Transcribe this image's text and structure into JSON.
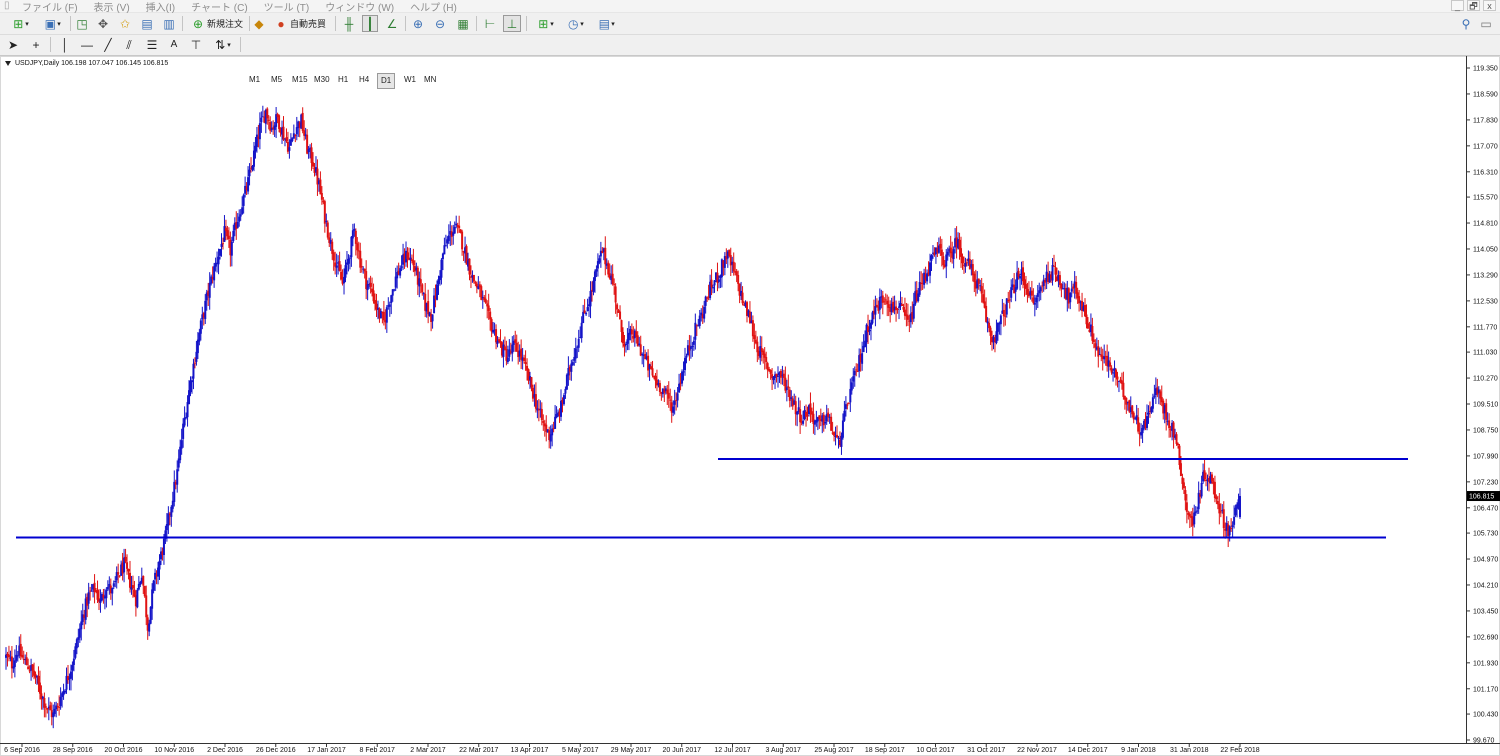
{
  "menu": {
    "items": [
      "ファイル (F)",
      "表示 (V)",
      "挿入(I)",
      "チャート (C)",
      "ツール (T)",
      "ウィンドウ (W)",
      "ヘルプ (H)"
    ],
    "window_controls": [
      "_",
      "🗗",
      "x"
    ]
  },
  "toolbar": {
    "new_order_label": "新規注文",
    "auto_trade_label": "自動売買"
  },
  "timeframes": [
    "M1",
    "M5",
    "M15",
    "M30",
    "H1",
    "H4",
    "D1",
    "W1",
    "MN"
  ],
  "active_timeframe": "D1",
  "chart": {
    "symbol_info": "USDJPY,Daily  106.198 107.047 106.145 106.815",
    "current_price": "106.815"
  },
  "colors": {
    "bull": "#1414c8",
    "bear": "#e01212",
    "hline": "#0000d0"
  },
  "chart_data": {
    "type": "candlestick",
    "symbol": "USDJPY",
    "timeframe": "Daily",
    "last_bar": {
      "open": 106.198,
      "high": 107.047,
      "low": 106.145,
      "close": 106.815
    },
    "current_price": 106.815,
    "ylim": [
      99.67,
      119.35
    ],
    "y_ticks": [
      "119.350",
      "118.590",
      "117.830",
      "117.070",
      "116.310",
      "115.570",
      "114.810",
      "114.050",
      "113.290",
      "112.530",
      "111.770",
      "111.030",
      "110.270",
      "109.510",
      "108.750",
      "107.990",
      "107.230",
      "106.470",
      "105.730",
      "104.970",
      "104.210",
      "103.450",
      "102.690",
      "101.930",
      "101.170",
      "100.430",
      "99.670"
    ],
    "x_ticks": [
      "6 Sep 2016",
      "28 Sep 2016",
      "20 Oct 2016",
      "10 Nov 2016",
      "2 Dec 2016",
      "26 Dec 2016",
      "17 Jan 2017",
      "8 Feb 2017",
      "2 Mar 2017",
      "22 Mar 2017",
      "13 Apr 2017",
      "5 May 2017",
      "29 May 2017",
      "20 Jun 2017",
      "12 Jul 2017",
      "3 Aug 2017",
      "25 Aug 2017",
      "18 Sep 2017",
      "10 Oct 2017",
      "31 Oct 2017",
      "22 Nov 2017",
      "14 Dec 2017",
      "9 Jan 2018",
      "31 Jan 2018",
      "22 Feb 2018"
    ],
    "close_path": [
      [
        0,
        102.1
      ],
      [
        4,
        101.9
      ],
      [
        8,
        102.3
      ],
      [
        12,
        102.0
      ],
      [
        16,
        101.8
      ],
      [
        20,
        101.5
      ],
      [
        24,
        101.0
      ],
      [
        28,
        100.6
      ],
      [
        32,
        100.4
      ],
      [
        36,
        100.8
      ],
      [
        40,
        101.3
      ],
      [
        44,
        101.8
      ],
      [
        48,
        102.5
      ],
      [
        52,
        103.3
      ],
      [
        56,
        103.9
      ],
      [
        60,
        104.1
      ],
      [
        64,
        103.7
      ],
      [
        68,
        104.2
      ],
      [
        72,
        104.0
      ],
      [
        76,
        104.5
      ],
      [
        80,
        104.8
      ],
      [
        84,
        104.3
      ],
      [
        88,
        103.8
      ],
      [
        92,
        104.6
      ],
      [
        96,
        103.0
      ],
      [
        100,
        104.2
      ],
      [
        104,
        104.9
      ],
      [
        108,
        105.6
      ],
      [
        112,
        106.6
      ],
      [
        116,
        107.5
      ],
      [
        120,
        108.8
      ],
      [
        124,
        109.9
      ],
      [
        128,
        110.9
      ],
      [
        132,
        111.8
      ],
      [
        136,
        112.6
      ],
      [
        140,
        113.3
      ],
      [
        144,
        113.9
      ],
      [
        148,
        114.5
      ],
      [
        152,
        114.0
      ],
      [
        156,
        114.8
      ],
      [
        160,
        115.4
      ],
      [
        164,
        116.0
      ],
      [
        168,
        116.8
      ],
      [
        172,
        117.6
      ],
      [
        176,
        118.1
      ],
      [
        180,
        117.6
      ],
      [
        184,
        117.9
      ],
      [
        188,
        117.4
      ],
      [
        192,
        117.0
      ],
      [
        196,
        117.6
      ],
      [
        200,
        117.8
      ],
      [
        204,
        117.0
      ],
      [
        208,
        116.6
      ],
      [
        212,
        115.9
      ],
      [
        216,
        115.0
      ],
      [
        220,
        114.2
      ],
      [
        224,
        113.6
      ],
      [
        228,
        113.0
      ],
      [
        232,
        113.8
      ],
      [
        236,
        114.6
      ],
      [
        240,
        113.7
      ],
      [
        244,
        113.1
      ],
      [
        248,
        112.8
      ],
      [
        252,
        112.2
      ],
      [
        256,
        111.9
      ],
      [
        260,
        112.6
      ],
      [
        264,
        113.2
      ],
      [
        268,
        113.6
      ],
      [
        272,
        113.9
      ],
      [
        276,
        113.6
      ],
      [
        280,
        113.0
      ],
      [
        284,
        112.4
      ],
      [
        288,
        112.1
      ],
      [
        292,
        112.9
      ],
      [
        296,
        113.9
      ],
      [
        300,
        114.4
      ],
      [
        304,
        114.7
      ],
      [
        308,
        114.4
      ],
      [
        312,
        113.8
      ],
      [
        316,
        113.2
      ],
      [
        320,
        112.9
      ],
      [
        324,
        112.4
      ],
      [
        328,
        111.9
      ],
      [
        332,
        111.5
      ],
      [
        336,
        111.1
      ],
      [
        340,
        110.9
      ],
      [
        344,
        111.2
      ],
      [
        348,
        111.0
      ],
      [
        352,
        110.5
      ],
      [
        356,
        110.0
      ],
      [
        360,
        109.4
      ],
      [
        364,
        108.9
      ],
      [
        368,
        108.6
      ],
      [
        372,
        109.0
      ],
      [
        376,
        109.4
      ],
      [
        380,
        110.2
      ],
      [
        384,
        110.9
      ],
      [
        388,
        111.5
      ],
      [
        392,
        112.2
      ],
      [
        396,
        112.7
      ],
      [
        400,
        113.4
      ],
      [
        404,
        114.0
      ],
      [
        408,
        113.5
      ],
      [
        412,
        112.9
      ],
      [
        416,
        111.8
      ],
      [
        420,
        111.2
      ],
      [
        424,
        111.6
      ],
      [
        428,
        111.3
      ],
      [
        432,
        110.9
      ],
      [
        436,
        110.5
      ],
      [
        440,
        110.2
      ],
      [
        444,
        110.0
      ],
      [
        448,
        109.7
      ],
      [
        452,
        109.4
      ],
      [
        456,
        110.1
      ],
      [
        460,
        110.8
      ],
      [
        464,
        111.3
      ],
      [
        468,
        111.8
      ],
      [
        472,
        112.2
      ],
      [
        476,
        112.8
      ],
      [
        480,
        113.1
      ],
      [
        484,
        113.4
      ],
      [
        488,
        113.9
      ],
      [
        492,
        113.5
      ],
      [
        496,
        113.0
      ],
      [
        500,
        112.4
      ],
      [
        504,
        112.0
      ],
      [
        508,
        111.3
      ],
      [
        512,
        110.9
      ],
      [
        516,
        110.6
      ],
      [
        520,
        110.3
      ],
      [
        524,
        110.4
      ],
      [
        528,
        110.1
      ],
      [
        532,
        109.7
      ],
      [
        536,
        109.3
      ],
      [
        540,
        109.1
      ],
      [
        544,
        109.4
      ],
      [
        548,
        109.0
      ],
      [
        552,
        108.9
      ],
      [
        556,
        109.2
      ],
      [
        560,
        108.7
      ],
      [
        564,
        108.3
      ],
      [
        568,
        109.1
      ],
      [
        572,
        109.9
      ],
      [
        576,
        110.4
      ],
      [
        580,
        111.1
      ],
      [
        584,
        111.8
      ],
      [
        588,
        112.2
      ],
      [
        592,
        112.5
      ],
      [
        596,
        112.7
      ],
      [
        600,
        112.3
      ],
      [
        604,
        112.4
      ],
      [
        608,
        112.1
      ],
      [
        612,
        111.8
      ],
      [
        616,
        112.6
      ],
      [
        620,
        113.0
      ],
      [
        624,
        113.4
      ],
      [
        628,
        113.8
      ],
      [
        632,
        114.0
      ],
      [
        636,
        113.7
      ],
      [
        640,
        113.9
      ],
      [
        644,
        114.3
      ],
      [
        648,
        113.8
      ],
      [
        652,
        113.6
      ],
      [
        656,
        113.2
      ],
      [
        660,
        112.8
      ],
      [
        664,
        112.0
      ],
      [
        668,
        111.4
      ],
      [
        672,
        111.7
      ],
      [
        676,
        112.2
      ],
      [
        680,
        112.6
      ],
      [
        684,
        113.1
      ],
      [
        688,
        113.3
      ],
      [
        692,
        112.9
      ],
      [
        696,
        112.4
      ],
      [
        700,
        112.8
      ],
      [
        704,
        113.2
      ],
      [
        708,
        113.4
      ],
      [
        712,
        113.3
      ],
      [
        716,
        113.0
      ],
      [
        720,
        112.6
      ],
      [
        724,
        112.9
      ],
      [
        728,
        112.5
      ],
      [
        732,
        112.0
      ],
      [
        736,
        111.5
      ],
      [
        740,
        111.0
      ],
      [
        744,
        110.8
      ],
      [
        748,
        110.6
      ],
      [
        752,
        110.3
      ],
      [
        756,
        109.9
      ],
      [
        760,
        109.6
      ],
      [
        764,
        109.2
      ],
      [
        768,
        108.8
      ],
      [
        772,
        108.9
      ],
      [
        776,
        109.6
      ],
      [
        780,
        109.9
      ],
      [
        784,
        109.4
      ],
      [
        788,
        109.0
      ],
      [
        792,
        108.6
      ],
      [
        796,
        107.6
      ],
      [
        800,
        106.4
      ],
      [
        804,
        106.0
      ],
      [
        808,
        106.8
      ],
      [
        812,
        107.5
      ],
      [
        816,
        107.3
      ],
      [
        820,
        106.8
      ],
      [
        824,
        106.2
      ],
      [
        828,
        105.8
      ],
      [
        832,
        106.1
      ],
      [
        836,
        106.815
      ]
    ],
    "horizontal_lines": [
      107.9,
      105.6
    ],
    "grid": false
  }
}
